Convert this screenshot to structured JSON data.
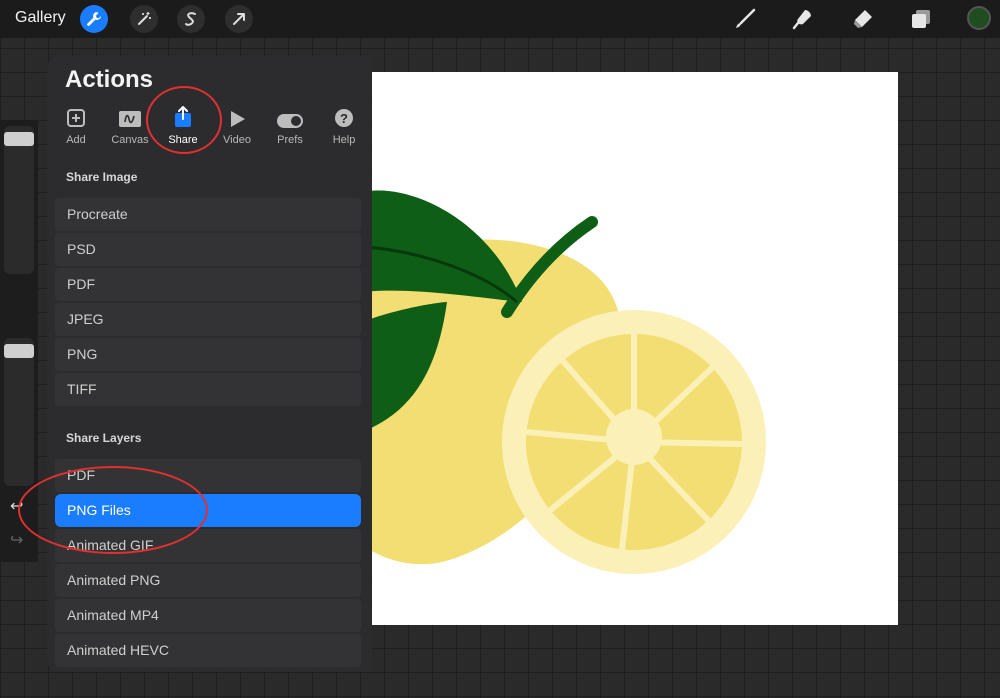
{
  "topbar": {
    "gallery_label": "Gallery",
    "left_tools": [
      "wrench-icon",
      "magic-wand-icon",
      "selection-s-icon",
      "transform-arrow-icon"
    ],
    "right_tools": [
      "brush-icon",
      "smudge-icon",
      "eraser-icon",
      "layers-icon"
    ],
    "current_color": "#1f4d1f"
  },
  "actions": {
    "title": "Actions",
    "tabs": [
      {
        "label": "Add",
        "icon": "add-icon"
      },
      {
        "label": "Canvas",
        "icon": "canvas-icon"
      },
      {
        "label": "Share",
        "icon": "share-icon"
      },
      {
        "label": "Video",
        "icon": "play-icon"
      },
      {
        "label": "Prefs",
        "icon": "toggle-icon"
      },
      {
        "label": "Help",
        "icon": "help-icon"
      }
    ],
    "selected_tab": "Share",
    "share_image": {
      "title": "Share Image",
      "items": [
        "Procreate",
        "PSD",
        "PDF",
        "JPEG",
        "PNG",
        "TIFF"
      ]
    },
    "share_layers": {
      "title": "Share Layers",
      "items": [
        "PDF",
        "PNG Files",
        "Animated GIF",
        "Animated PNG",
        "Animated MP4",
        "Animated HEVC"
      ],
      "selected": "PNG Files"
    }
  },
  "colors": {
    "accent": "#1a7cff",
    "annotation": "#e03030",
    "lemon": "#f3de73",
    "leaf": "#0f5e16"
  }
}
